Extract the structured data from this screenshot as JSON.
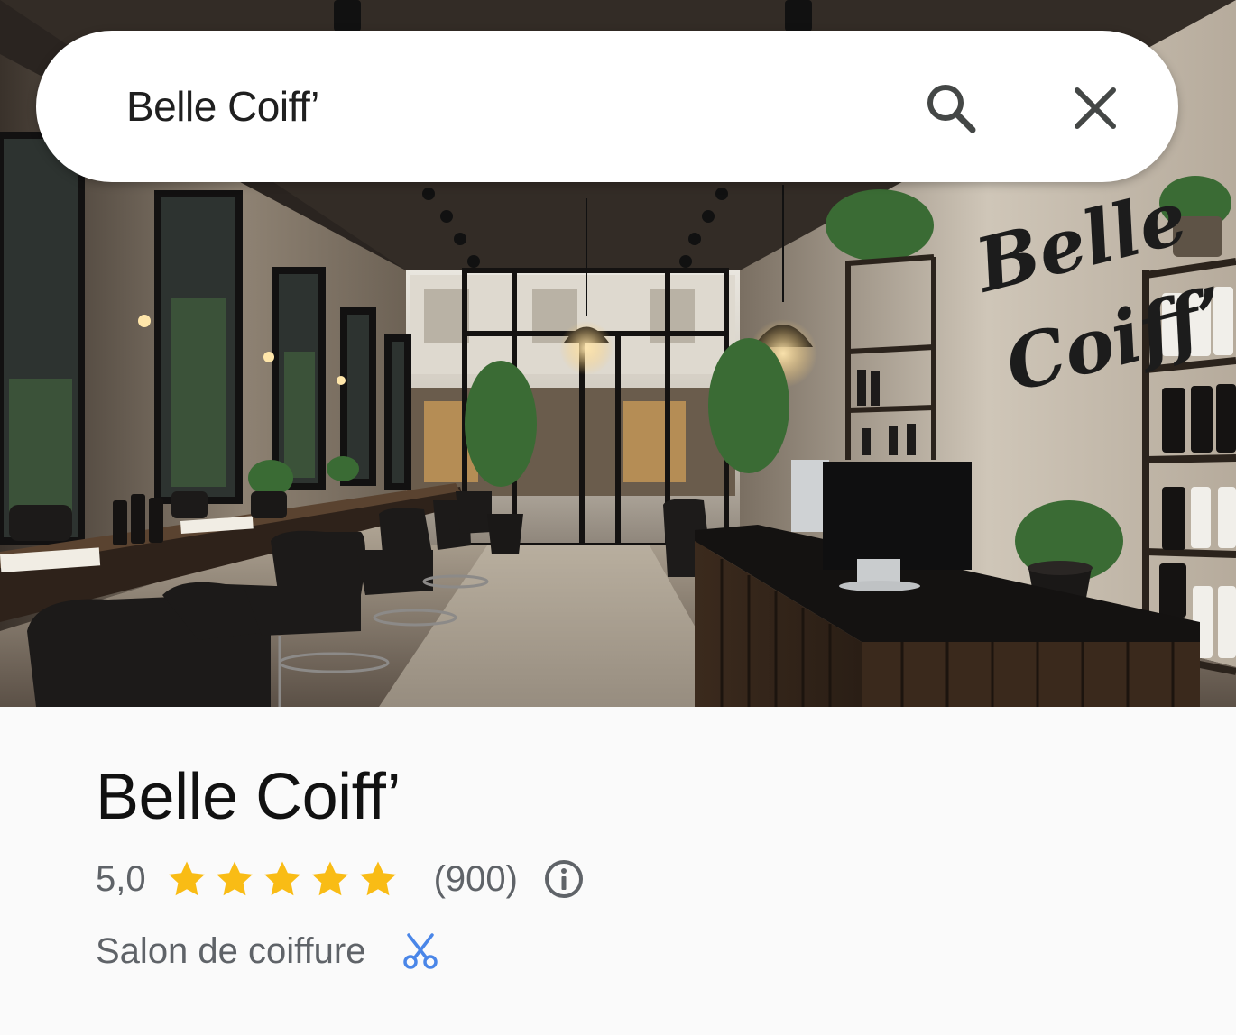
{
  "search": {
    "query": "Belle Coiff’"
  },
  "hero": {
    "wall_sign": "Belle Coiff’"
  },
  "place": {
    "name": "Belle Coiff’",
    "rating": "5,0",
    "rating_value": 5.0,
    "rating_max": 5,
    "review_count": "(900)",
    "category": "Salon de coiffure"
  },
  "icons": {
    "search": "search-icon",
    "close": "close-icon",
    "star": "star-icon",
    "info": "info-icon",
    "category": "scissors-icon"
  },
  "colors": {
    "star": "#F9BC15",
    "text_primary": "#111111",
    "text_secondary": "#5F6368",
    "category_icon": "#4A86E8"
  }
}
